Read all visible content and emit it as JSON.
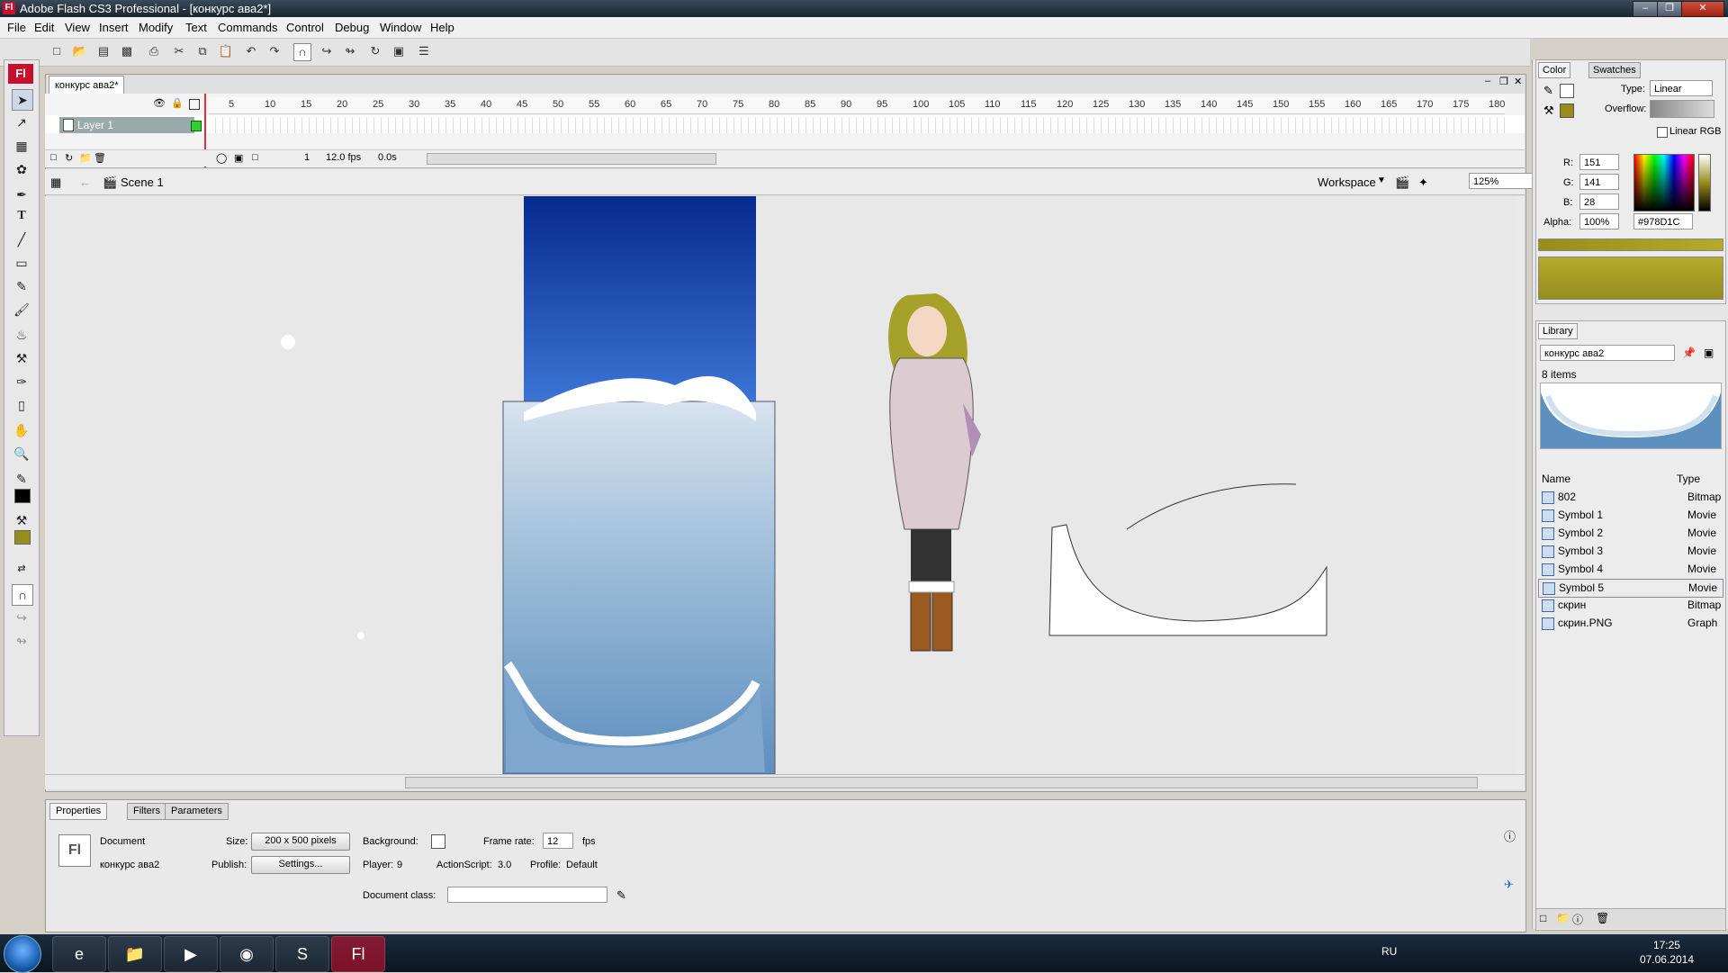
{
  "window": {
    "title": "Adobe Flash CS3 Professional - [конкурс ава2*]"
  },
  "menu": [
    "File",
    "Edit",
    "View",
    "Insert",
    "Modify",
    "Text",
    "Commands",
    "Control",
    "Debug",
    "Window",
    "Help"
  ],
  "document": {
    "tab_label": "конкурс ава2*"
  },
  "timeline": {
    "ruler": [
      "5",
      "10",
      "15",
      "20",
      "25",
      "30",
      "35",
      "40",
      "45",
      "50",
      "55",
      "60",
      "65",
      "70",
      "75",
      "80",
      "85",
      "90",
      "95",
      "100",
      "105",
      "110",
      "115",
      "120",
      "125",
      "130",
      "135",
      "140",
      "145",
      "150",
      "155",
      "160",
      "165",
      "170",
      "175",
      "180"
    ],
    "layer_name": "Layer 1",
    "current_frame": "1",
    "fps": "12.0 fps",
    "elapsed": "0.0s"
  },
  "scene": {
    "name": "Scene 1",
    "workspace_label": "Workspace",
    "zoom": "125%"
  },
  "properties": {
    "tabs": [
      "Properties",
      "Filters",
      "Parameters"
    ],
    "kind": "Document",
    "doc_name": "конкурс ава2",
    "size_label": "Size:",
    "size_value": "200 x 500 pixels",
    "background_label": "Background:",
    "frame_rate_label": "Frame rate:",
    "frame_rate_value": "12",
    "fps_unit": "fps",
    "publish_label": "Publish:",
    "settings_button": "Settings...",
    "player_label": "Player:",
    "player_value": "9",
    "actionscript_label": "ActionScript:",
    "actionscript_value": "3.0",
    "profile_label": "Profile:",
    "profile_value": "Default",
    "doc_class_label": "Document class:",
    "doc_class_value": "",
    "fl_badge": "Fl"
  },
  "color_panel": {
    "tabs": [
      "Color",
      "Swatches"
    ],
    "type_label": "Type:",
    "type_value": "Linear",
    "overflow_label": "Overflow:",
    "linear_rgb": "Linear RGB",
    "r_label": "R:",
    "r_value": "151",
    "g_label": "G:",
    "g_value": "141",
    "b_label": "B:",
    "b_value": "28",
    "alpha_label": "Alpha:",
    "alpha_value": "100%",
    "hex_value": "#978D1C",
    "swatch_color": "#978D1C"
  },
  "library": {
    "tab": "Library",
    "doc_select": "конкурс ава2",
    "count": "8 items",
    "col_name": "Name",
    "col_type": "Type",
    "items": [
      {
        "name": "802",
        "type": "Bitmap"
      },
      {
        "name": "Symbol 1",
        "type": "Movie"
      },
      {
        "name": "Symbol 2",
        "type": "Movie"
      },
      {
        "name": "Symbol 3",
        "type": "Movie"
      },
      {
        "name": "Symbol 4",
        "type": "Movie"
      },
      {
        "name": "Symbol 5",
        "type": "Movie"
      },
      {
        "name": "скрин",
        "type": "Bitmap"
      },
      {
        "name": "скрин.PNG",
        "type": "Graph"
      }
    ]
  },
  "taskbar": {
    "lang": "RU",
    "time": "17:25",
    "date": "07.06.2014"
  }
}
